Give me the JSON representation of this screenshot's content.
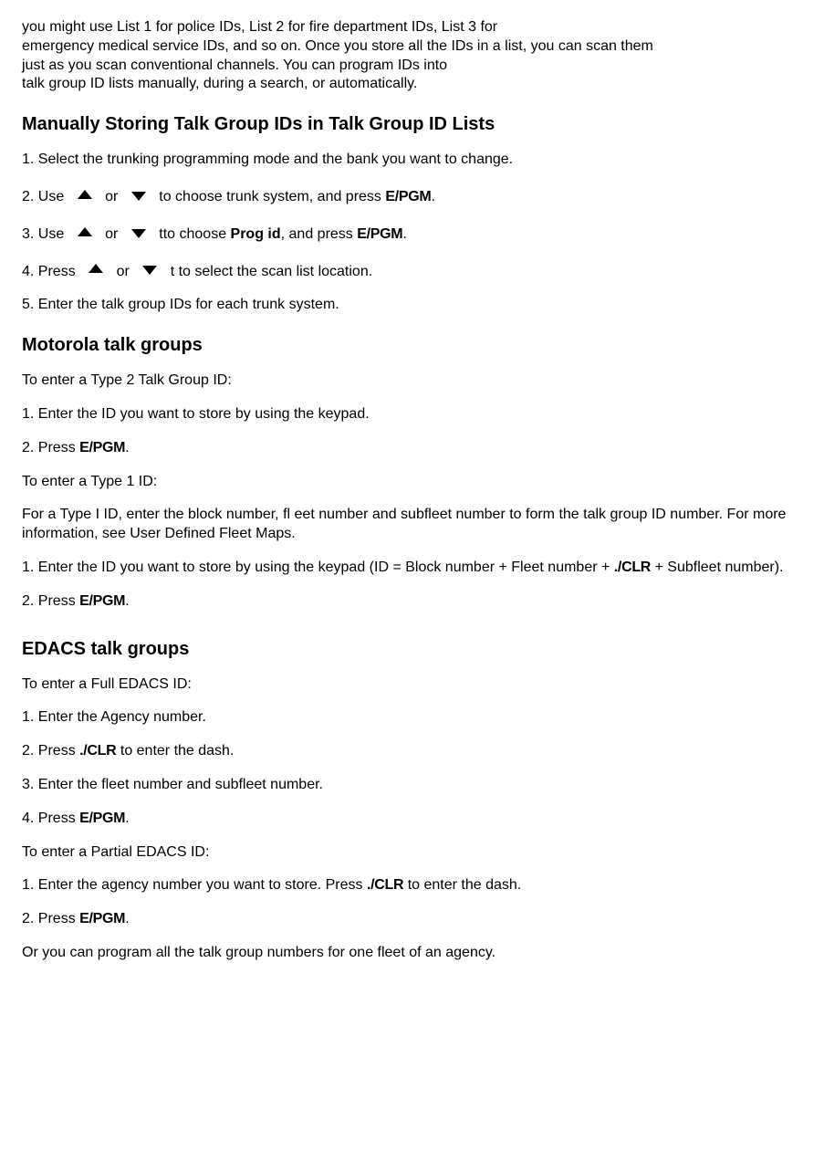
{
  "intro": {
    "line1": "you might use List 1 for police IDs, List 2 for fire department IDs, List 3 for",
    "line2": "emergency medical service IDs, and so on. Once you store all the IDs in a list, you can scan them",
    "line3": "just as you scan conventional channels. You can program IDs into",
    "line4": "talk group ID lists manually, during a search, or automatically."
  },
  "heading1": "Manually Storing Talk Group IDs in Talk Group ID Lists",
  "step1": "1. Select the trunking programming mode and the bank you want to change.",
  "step2a": "2. Use ",
  "step2b": " or ",
  "step2c": " to choose trunk system, and press ",
  "step2d": "E/PGM",
  "step2e": ".",
  "step3a": "3. Use ",
  "step3b": " or ",
  "step3c": " tto choose ",
  "step3d": "Prog id",
  "step3e": ", and press ",
  "step3f": "E/PGM",
  "step3g": ".",
  "step4a": "4. Press ",
  "step4b": " or ",
  "step4c": " t to select the scan list location.",
  "step5": "5. Enter the talk group IDs for each trunk system.",
  "heading2": "Motorola talk groups",
  "moto_type2_intro": "To enter a Type 2 Talk Group ID:",
  "moto_type2_step1": "1. Enter the ID you want to store by using the keypad.",
  "moto_type2_step2a": "2. Press ",
  "moto_type2_step2b": "E/PGM",
  "moto_type2_step2c": ".",
  "moto_type1_intro": "To enter a Type 1 ID:",
  "moto_type1_desc": "For a Type I ID, enter the block number, fl eet number and subfleet number to form the talk group ID number. For more information, see User Defined Fleet Maps.",
  "moto_type1_step1a": "1. Enter the ID you want to store by using the keypad (ID = Block number + Fleet number + ",
  "moto_type1_step1b": "./CLR",
  "moto_type1_step1c": " + Subfleet number).",
  "moto_type1_step2a": "2. Press ",
  "moto_type1_step2b": "E/PGM",
  "moto_type1_step2c": ".",
  "heading3": "EDACS talk groups",
  "edacs_full_intro": "To enter a Full EDACS ID:",
  "edacs_full_step1": "1. Enter the Agency number.",
  "edacs_full_step2a": "2. Press ",
  "edacs_full_step2b": "./CLR",
  "edacs_full_step2c": " to enter the dash.",
  "edacs_full_step3": "3. Enter the fleet number and subfleet number.",
  "edacs_full_step4a": "4. Press ",
  "edacs_full_step4b": "E/PGM",
  "edacs_full_step4c": ".",
  "edacs_partial_intro": "To enter a Partial EDACS ID:",
  "edacs_partial_step1a": "1. Enter the agency number you want to store. Press ",
  "edacs_partial_step1b": "./CLR",
  "edacs_partial_step1c": " to enter the dash.",
  "edacs_partial_step2a": "2. Press ",
  "edacs_partial_step2b": "E/PGM",
  "edacs_partial_step2c": ".",
  "edacs_outro": "Or you can program all the talk group numbers for one fleet of an agency."
}
